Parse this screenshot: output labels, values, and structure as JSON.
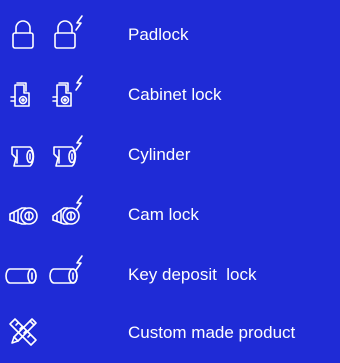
{
  "theme": {
    "background": "#1f2bd6",
    "foreground": "#ffffff"
  },
  "lock_types": [
    {
      "label": "Padlock",
      "icons": [
        "padlock-icon",
        "smart-padlock-icon"
      ]
    },
    {
      "label": "Cabinet lock",
      "icons": [
        "cabinet-lock-icon",
        "smart-cabinet-lock-icon"
      ]
    },
    {
      "label": "Cylinder",
      "icons": [
        "cylinder-icon",
        "smart-cylinder-icon"
      ]
    },
    {
      "label": "Cam lock",
      "icons": [
        "cam-lock-icon",
        "smart-cam-lock-icon"
      ]
    },
    {
      "label": "Key deposit  lock",
      "icons": [
        "key-deposit-lock-icon",
        "smart-key-deposit-lock-icon"
      ]
    },
    {
      "label": "Custom made product",
      "icons": [
        "ruler-pencil-icon"
      ]
    }
  ]
}
